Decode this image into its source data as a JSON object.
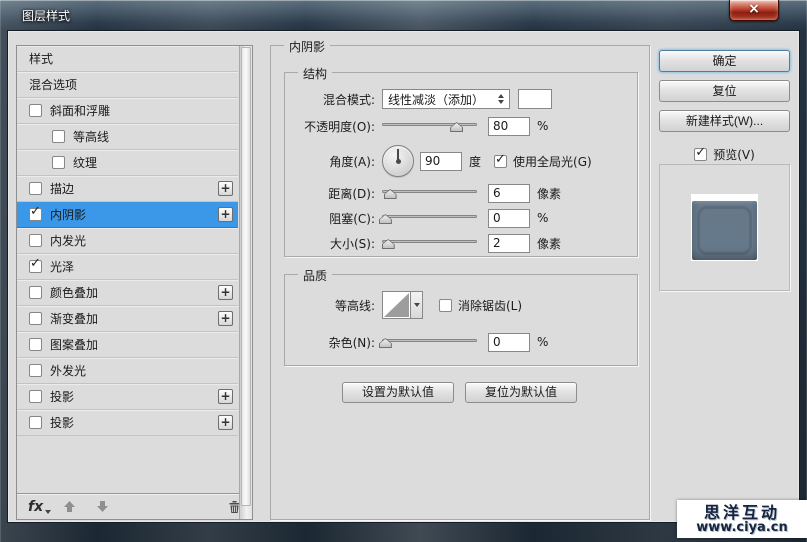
{
  "window": {
    "title": "图层样式"
  },
  "icons": {
    "check": "✓",
    "plus": "+",
    "close": "×"
  },
  "colors": {
    "selection_bg": "#3b97e8",
    "dialog_bg": "#dcdcdc",
    "close_red": "#bc4632",
    "blend_swatch": "#ffffff",
    "preview_fill": "#66798a",
    "ok_focus_ring": "#8fc0e2"
  },
  "sidebar": {
    "items": [
      {
        "id": "styles",
        "label": "样式",
        "checkbox": false,
        "checked": false,
        "indent": false,
        "plus": false,
        "selected": false
      },
      {
        "id": "blending-options",
        "label": "混合选项",
        "checkbox": false,
        "checked": false,
        "indent": false,
        "plus": false,
        "selected": false
      },
      {
        "id": "bevel-emboss",
        "label": "斜面和浮雕",
        "checkbox": true,
        "checked": false,
        "indent": false,
        "plus": false,
        "selected": false
      },
      {
        "id": "contour",
        "label": "等高线",
        "checkbox": true,
        "checked": false,
        "indent": true,
        "plus": false,
        "selected": false
      },
      {
        "id": "texture",
        "label": "纹理",
        "checkbox": true,
        "checked": false,
        "indent": true,
        "plus": false,
        "selected": false
      },
      {
        "id": "stroke",
        "label": "描边",
        "checkbox": true,
        "checked": false,
        "indent": false,
        "plus": true,
        "selected": false
      },
      {
        "id": "inner-shadow",
        "label": "内阴影",
        "checkbox": true,
        "checked": true,
        "indent": false,
        "plus": true,
        "selected": true
      },
      {
        "id": "inner-glow",
        "label": "内发光",
        "checkbox": true,
        "checked": false,
        "indent": false,
        "plus": false,
        "selected": false
      },
      {
        "id": "satin",
        "label": "光泽",
        "checkbox": true,
        "checked": true,
        "indent": false,
        "plus": false,
        "selected": false
      },
      {
        "id": "color-overlay",
        "label": "颜色叠加",
        "checkbox": true,
        "checked": false,
        "indent": false,
        "plus": true,
        "selected": false
      },
      {
        "id": "gradient-overlay",
        "label": "渐变叠加",
        "checkbox": true,
        "checked": false,
        "indent": false,
        "plus": true,
        "selected": false
      },
      {
        "id": "pattern-overlay",
        "label": "图案叠加",
        "checkbox": true,
        "checked": false,
        "indent": false,
        "plus": false,
        "selected": false
      },
      {
        "id": "outer-glow",
        "label": "外发光",
        "checkbox": true,
        "checked": false,
        "indent": false,
        "plus": false,
        "selected": false
      },
      {
        "id": "drop-shadow",
        "label": "投影",
        "checkbox": true,
        "checked": false,
        "indent": false,
        "plus": true,
        "selected": false
      },
      {
        "id": "drop-shadow-2",
        "label": "投影",
        "checkbox": true,
        "checked": false,
        "indent": false,
        "plus": true,
        "selected": false
      }
    ],
    "toolbar": {
      "fx_label": "fx"
    }
  },
  "main": {
    "title": "内阴影",
    "structure": {
      "legend": "结构",
      "blend_mode": {
        "label": "混合模式:",
        "value": "线性减淡（添加）"
      },
      "opacity": {
        "label": "不透明度(O):",
        "value": "80",
        "unit": "%",
        "thumb_pct": 78
      },
      "angle": {
        "label": "角度(A):",
        "value": "90",
        "unit": "度",
        "global_light_label": "使用全局光(G)",
        "global_light_checked": true
      },
      "distance": {
        "label": "距离(D):",
        "value": "6",
        "unit": "像素",
        "thumb_pct": 8
      },
      "choke": {
        "label": "阻塞(C):",
        "value": "0",
        "unit": "%",
        "thumb_pct": 3
      },
      "size": {
        "label": "大小(S):",
        "value": "2",
        "unit": "像素",
        "thumb_pct": 6
      }
    },
    "quality": {
      "legend": "品质",
      "contour": {
        "label": "等高线:",
        "antialias_label": "消除锯齿(L)",
        "antialias_checked": false
      },
      "noise": {
        "label": "杂色(N):",
        "value": "0",
        "unit": "%",
        "thumb_pct": 3
      }
    },
    "default_buttons": {
      "set_default": "设置为默认值",
      "reset_default": "复位为默认值"
    }
  },
  "actions": {
    "ok": "确定",
    "reset": "复位",
    "new_style": "新建样式(W)...",
    "preview": {
      "label": "预览(V)",
      "checked": true
    }
  },
  "watermark": {
    "line1": "思洋互动",
    "line2": "www.ciya.cn"
  }
}
